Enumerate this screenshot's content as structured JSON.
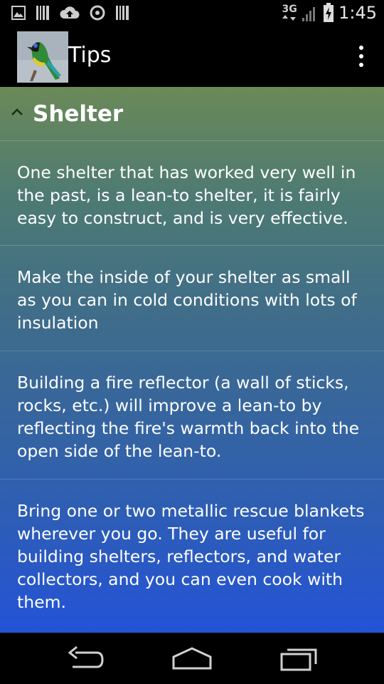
{
  "status_bar": {
    "network_type": "3G",
    "time": "1:45"
  },
  "action_bar": {
    "title": "Tips",
    "app_icon": "bird-icon"
  },
  "section": {
    "title": "Shelter",
    "tips": [
      {
        "text": "One shelter that has worked very well in the past, is a lean-to shelter, it is fairly easy to construct, and is very effective."
      },
      {
        "text": "Make the inside of your shelter as small as you can in cold conditions with lots of insulation"
      },
      {
        "text": "Building a fire reflector (a wall of sticks, rocks, etc.) will improve a lean-to by reflecting the fire's warmth back into the open side of the lean-to."
      },
      {
        "text": "Bring one or two metallic rescue blankets wherever you go. They are useful for building shelters, reflectors, and water collectors, and you can even cook with them."
      }
    ]
  },
  "nav_bar": {
    "back": "back-icon",
    "home": "home-icon",
    "recents": "recents-icon"
  }
}
